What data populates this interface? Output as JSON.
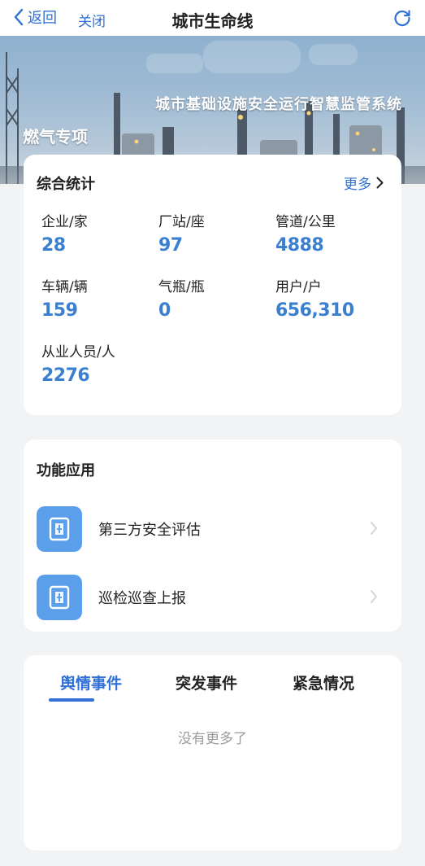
{
  "nav": {
    "back_label": "返回",
    "close_label": "关闭",
    "title": "城市生命线"
  },
  "banner": {
    "system_title": "城市基础设施安全运行智慧监管系统",
    "topic": "燃气专项"
  },
  "stats": {
    "title": "综合统计",
    "more_label": "更多",
    "items": [
      {
        "label": "企业/家",
        "value": "28"
      },
      {
        "label": "厂站/座",
        "value": "97"
      },
      {
        "label": "管道/公里",
        "value": "4888"
      },
      {
        "label": "车辆/辆",
        "value": "159"
      },
      {
        "label": "气瓶/瓶",
        "value": "0"
      },
      {
        "label": "用户/户",
        "value": "656,310"
      },
      {
        "label": "从业人员/人",
        "value": "2276"
      }
    ]
  },
  "apps": {
    "title": "功能应用",
    "items": [
      {
        "label": "第三方安全评估"
      },
      {
        "label": "巡检巡查上报"
      }
    ]
  },
  "events": {
    "tabs": [
      {
        "label": "舆情事件",
        "active": true
      },
      {
        "label": "突发事件",
        "active": false
      },
      {
        "label": "紧急情况",
        "active": false
      }
    ],
    "empty_text": "没有更多了"
  },
  "colors": {
    "accent": "#2f6fd6",
    "stat_value": "#3a7fd0",
    "app_icon_bg": "#5b9ee9",
    "page_bg": "#f2f3f5"
  },
  "icons": {
    "back": "chevron-left-icon",
    "refresh": "refresh-icon",
    "more": "chevron-right-icon",
    "app": "document-icon"
  }
}
